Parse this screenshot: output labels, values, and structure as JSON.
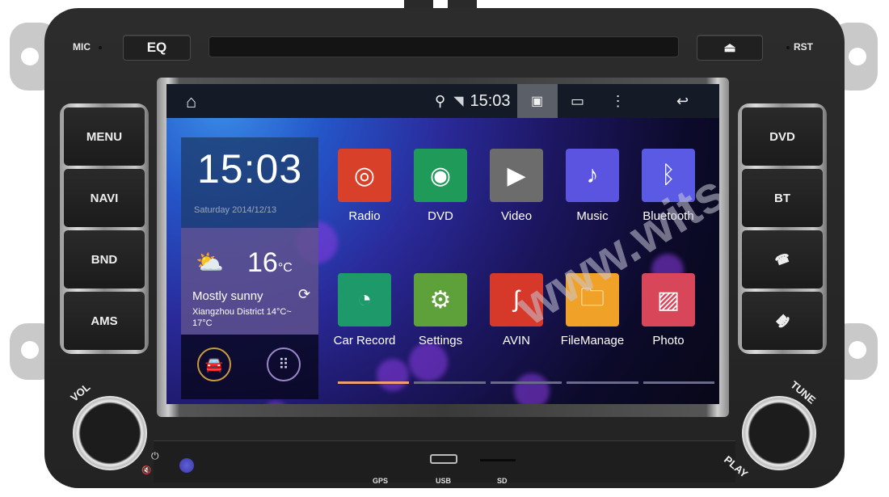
{
  "device": {
    "mic_label": "MIC",
    "rst_label": "RST",
    "eq_button": "EQ",
    "eject_icon": "eject-icon",
    "eject_glyph": "⏏",
    "left_buttons": [
      "MENU",
      "NAVI",
      "BND",
      "AMS"
    ],
    "right_buttons": [
      {
        "label": "DVD",
        "icon": null
      },
      {
        "label": "BT",
        "icon": null
      },
      {
        "label": "☎",
        "icon": "call-answer-icon"
      },
      {
        "label": "☎",
        "icon": "call-hangup-icon"
      }
    ],
    "vol_label": "VOL",
    "tune_label": "TUNE",
    "play_label": "PLAY",
    "ports": {
      "gps": "GPS",
      "usb": "USB",
      "sd": "SD"
    },
    "power_glyph": "⏻",
    "mute_glyph": "🔇"
  },
  "statusbar": {
    "home_glyph": "⌂",
    "location_glyph": "⚲",
    "wifi_glyph": "◥",
    "time": "15:03",
    "screenshot_glyph": "▣",
    "recents_glyph": "▭",
    "menu_glyph": "⋮",
    "back_glyph": "↩"
  },
  "clock_widget": {
    "time": "15:03",
    "date": "Saturday 2014/12/13"
  },
  "weather_widget": {
    "icon_glyph": "⛅",
    "temperature": "16",
    "unit": "°C",
    "condition": "Mostly sunny",
    "location_range": "Xiangzhou District 14°C~ 17°C",
    "refresh_glyph": "⟳"
  },
  "dock": {
    "car_glyph": "🚘",
    "apps_glyph": "⠿"
  },
  "apps": [
    {
      "label": "Radio",
      "glyph": "◎",
      "color": "#d8402a"
    },
    {
      "label": "DVD",
      "glyph": "◉",
      "color": "#1f9a58"
    },
    {
      "label": "Video",
      "glyph": "▶",
      "color": "#6c6c6c"
    },
    {
      "label": "Music",
      "glyph": "♪",
      "color": "#5a54e0"
    },
    {
      "label": "Bluetooth",
      "glyph": "ᛒ",
      "color": "#5a5ae4"
    },
    {
      "label": "Car Record",
      "glyph": "◔",
      "color": "#1e9a6a"
    },
    {
      "label": "Settings",
      "glyph": "⚙",
      "color": "#5ea03a"
    },
    {
      "label": "AVIN",
      "glyph": "ʃ",
      "color": "#d6382a"
    },
    {
      "label": "FileManage",
      "glyph": "🗀",
      "color": "#f0a228"
    },
    {
      "label": "Photo",
      "glyph": "▨",
      "color": "#d8465a"
    }
  ],
  "pager": {
    "pages": 5,
    "current": 1
  },
  "watermark": "www.witson.com"
}
